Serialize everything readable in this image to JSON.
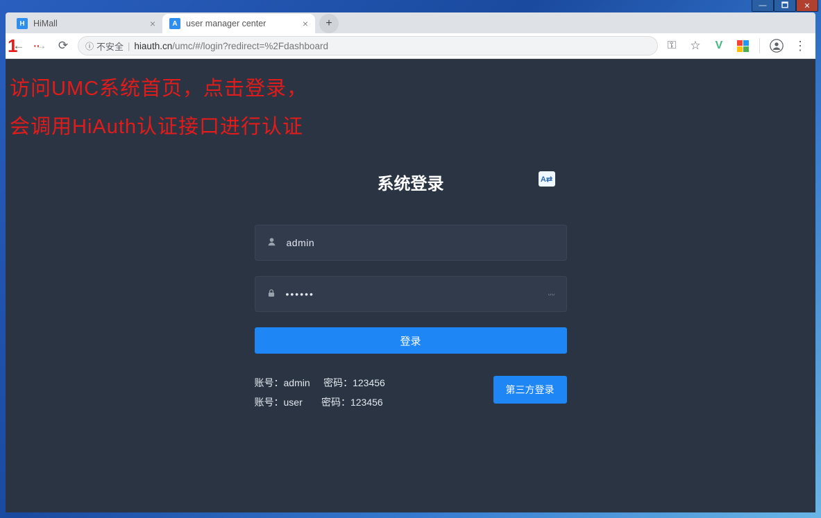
{
  "window": {
    "minimize_glyph": "—",
    "maximize_glyph": "🗖",
    "close_glyph": "✕"
  },
  "tabs": [
    {
      "title": "HiMall",
      "favicon_letter": "H",
      "active": false
    },
    {
      "title": "user manager center",
      "favicon_letter": "A",
      "active": true
    }
  ],
  "newtab_glyph": "+",
  "browser": {
    "back_glyph": "←",
    "fwd_glyph": "→",
    "reload_glyph": "⟳",
    "insecure_text": "不安全",
    "url_host": "hiauth.cn",
    "url_path": "/umc/#/login?redirect=%2Fdashboard",
    "key_glyph": "⚿",
    "star_glyph": "☆",
    "vue_glyph": "V",
    "avatar_glyph": "👤",
    "menu_glyph": "⋮"
  },
  "annotation": {
    "step_number": "1",
    "line1": "访问UMC系统首页，点击登录，",
    "line2": "会调用HiAuth认证接口进行认证"
  },
  "login": {
    "title": "系统登录",
    "lang_badge": "A⇄",
    "username_value": "admin",
    "password_value": "••••••",
    "login_button": "登录",
    "hint_user1": "账号：admin",
    "hint_pass1": "密码：123456",
    "hint_user2": "账号：user",
    "hint_pass2": "密码：123456",
    "third_party_button": "第三方登录",
    "eye_glyph": "ᵕᵕ"
  }
}
